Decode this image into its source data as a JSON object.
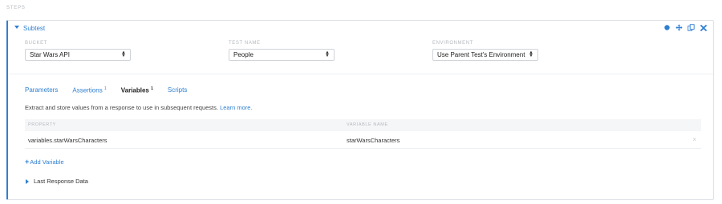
{
  "section": {
    "title": "STEPS"
  },
  "card": {
    "title": "Subtest",
    "accent_color": "#2f7fd1",
    "icons": [
      "status-dot-icon",
      "move-icon",
      "duplicate-icon",
      "close-icon"
    ]
  },
  "fields": {
    "bucket": {
      "label": "BUCKET",
      "value": "Star Wars API"
    },
    "test_name": {
      "label": "TEST NAME",
      "value": "People"
    },
    "environment": {
      "label": "ENVIRONMENT",
      "value": "Use Parent Test's Environment"
    }
  },
  "tabs": [
    {
      "label": "Parameters",
      "badge": ""
    },
    {
      "label": "Assertions",
      "badge": "1"
    },
    {
      "label": "Variables",
      "badge": "1"
    },
    {
      "label": "Scripts",
      "badge": ""
    }
  ],
  "active_tab": "Variables",
  "variables": {
    "description": "Extract and store values from a response to use in subsequent requests.",
    "learn_more": "Learn more.",
    "columns": {
      "property": "PROPERTY",
      "variable_name": "VARIABLE NAME"
    },
    "rows": [
      {
        "property": "variables.starWarsCharacters",
        "variable_name": "starWarsCharacters"
      }
    ],
    "add_label": "Add Variable",
    "remove_glyph": "×"
  },
  "last_response": {
    "label": "Last Response Data"
  }
}
